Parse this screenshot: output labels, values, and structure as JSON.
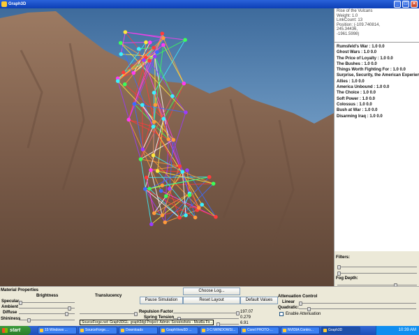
{
  "window": {
    "title": "Graph3D",
    "minimize": "_",
    "maximize": "□",
    "close": "×"
  },
  "info": {
    "lines": [
      "Rise of the Vulcans",
      "Weight: 1.0",
      "LinkCount: 13",
      "Position: (-109.740814,",
      "245.34436,",
      "-1961.5998)"
    ]
  },
  "node_list": [
    "Rumsfeld's War : 1.0 0.0",
    "Ghost Wars : 1.0 0.0",
    "The Price of Loyalty : 1.0 0.0",
    "The Bushes : 1.0 0.0",
    "Things Worth Fighting For : 1.0 0.0",
    "Surprise, Security, the American Experience",
    "Allies : 1.0 0.0",
    "America Unbound : 1.0 0.0",
    "The Choice : 1.0 0.0",
    "Soft Power : 1.0 0.0",
    "Colossus : 1.0 0.0",
    "Bush at War : 1.0 0.0",
    "Disarming Iraq : 1.0 0.0"
  ],
  "filters": {
    "label": "Filters:",
    "fog_depth_label": "Fog Depth:",
    "fog_depth": 0.75
  },
  "controls": {
    "material_properties": "Material Properties",
    "brightness": "Brightness",
    "translucency": "Translucency",
    "specular": "Specular",
    "ambient": "Ambient",
    "diffuse": "Diffuse",
    "shininess": "Shininess",
    "choose_log": "Choose Log...",
    "pause_simulation": "Pause Simulation",
    "reset_layout": "Reset Layout",
    "default_values": "Default Values",
    "repulsion_factor": "Repulsion Factor",
    "repulsion_value": "197.07",
    "spring_tension": "Spring Tension",
    "spring_value": "0.279",
    "third_value": "6.91",
    "attenuation_control": "Attenuation Control",
    "linear": "Linear",
    "quadratic": "Quadratic:",
    "enable_attenuation": "Enable Attenuation",
    "tooltip": "SourceForge.net: Graph3DGL: graph3dgl Project: Admin: Screenshots - Mozilla Fir..."
  },
  "taskbar": {
    "start": "start",
    "tasks": [
      "15 Windows ...",
      "SourceForge....",
      "Downloads",
      "GraphView3D ...",
      "3 C:\\WINDOWS\\...",
      "Corel PHOTO-...",
      "NVIDIA Contro...",
      "Graph3D"
    ],
    "clock": "10:39 AM"
  },
  "colors": {
    "accent": "#2a62d9",
    "panel": "#ece9d8",
    "mountain": "#8a6a55"
  }
}
